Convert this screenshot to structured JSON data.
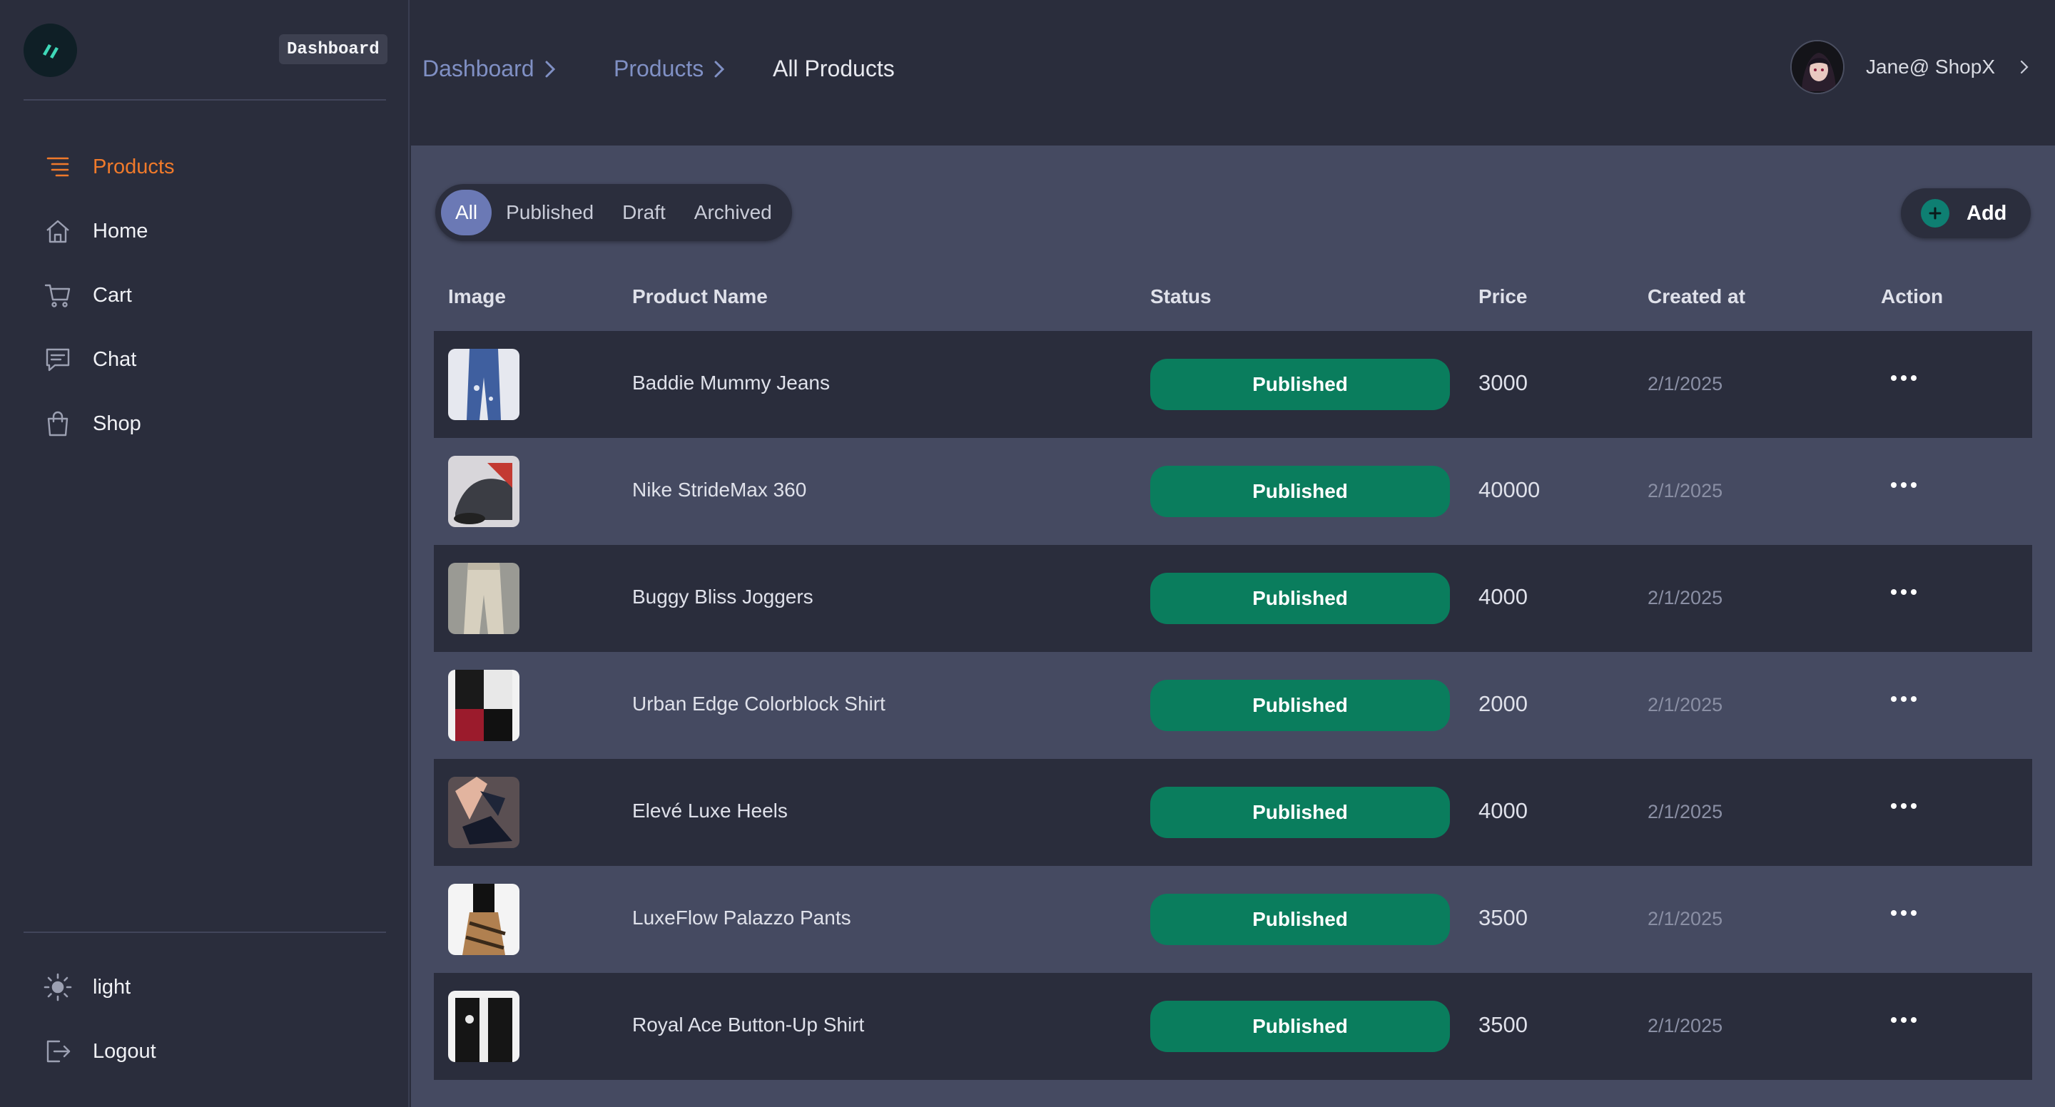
{
  "sidebar": {
    "brand_tag": "Dashboard",
    "logo_icon": "brand-logo-icon",
    "items": [
      {
        "label": "Products",
        "icon": "list-icon",
        "active": true
      },
      {
        "label": "Home",
        "icon": "home-icon"
      },
      {
        "label": "Cart",
        "icon": "cart-icon"
      },
      {
        "label": "Chat",
        "icon": "chat-icon"
      },
      {
        "label": "Shop",
        "icon": "shopping-bag-icon"
      }
    ],
    "footer_items": [
      {
        "label": "light",
        "icon": "sun-icon"
      },
      {
        "label": "Logout",
        "icon": "logout-icon"
      }
    ]
  },
  "breadcrumb": {
    "items": [
      "Dashboard",
      "Products",
      "All Products"
    ]
  },
  "user": {
    "name": "Jane@ ShopX"
  },
  "filters": {
    "tabs": [
      "All",
      "Published",
      "Draft",
      "Archived"
    ],
    "active": "All"
  },
  "add_button": {
    "label": "Add"
  },
  "table": {
    "columns": [
      "Image",
      "Product Name",
      "Status",
      "Price",
      "Created at",
      "Action"
    ],
    "rows": [
      {
        "name": "Baddie Mummy Jeans",
        "status": "Published",
        "price": "3000",
        "created": "2/1/2025"
      },
      {
        "name": "Nike StrideMax 360",
        "status": "Published",
        "price": "40000",
        "created": "2/1/2025"
      },
      {
        "name": "Buggy Bliss Joggers",
        "status": "Published",
        "price": "4000",
        "created": "2/1/2025"
      },
      {
        "name": "Urban Edge Colorblock Shirt",
        "status": "Published",
        "price": "2000",
        "created": "2/1/2025"
      },
      {
        "name": "Elevé Luxe Heels",
        "status": "Published",
        "price": "4000",
        "created": "2/1/2025"
      },
      {
        "name": "LuxeFlow Palazzo Pants",
        "status": "Published",
        "price": "3500",
        "created": "2/1/2025"
      },
      {
        "name": "Royal Ace Button-Up Shirt",
        "status": "Published",
        "price": "3500",
        "created": "2/1/2025"
      }
    ]
  },
  "colors": {
    "accent": "#f07a2b",
    "status_published": "#0a7d5d",
    "link": "#8090c4",
    "active_tab": "#6b79b5"
  }
}
